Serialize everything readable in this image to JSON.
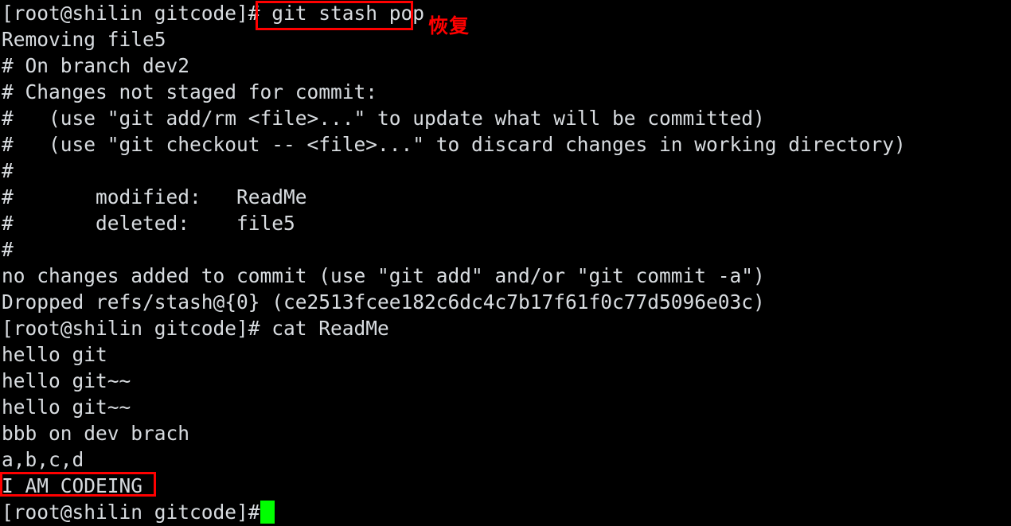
{
  "terminal": {
    "background_color": "#000000",
    "text_color": "#d8dce0",
    "annotation_color": "#ff0000",
    "cursor_color": "#00ff00",
    "prompt": "[root@shilin gitcode]# ",
    "lines": [
      {
        "id": "line-1",
        "text": "[root@shilin gitcode]# git stash pop"
      },
      {
        "id": "line-2",
        "text": "Removing file5"
      },
      {
        "id": "line-3",
        "text": "# On branch dev2"
      },
      {
        "id": "line-4",
        "text": "# Changes not staged for commit:"
      },
      {
        "id": "line-5",
        "text": "#   (use \"git add/rm <file>...\" to update what will be committed)"
      },
      {
        "id": "line-6",
        "text": "#   (use \"git checkout -- <file>...\" to discard changes in working directory)"
      },
      {
        "id": "line-7",
        "text": "#"
      },
      {
        "id": "line-8",
        "text": "#       modified:   ReadMe"
      },
      {
        "id": "line-9",
        "text": "#       deleted:    file5"
      },
      {
        "id": "line-10",
        "text": "#"
      },
      {
        "id": "line-11",
        "text": "no changes added to commit (use \"git add\" and/or \"git commit -a\")"
      },
      {
        "id": "line-12",
        "text": "Dropped refs/stash@{0} (ce2513fcee182c6dc4c7b17f61f0c77d5096e03c)"
      },
      {
        "id": "line-13",
        "text": "[root@shilin gitcode]# cat ReadMe"
      },
      {
        "id": "line-14",
        "text": "hello git"
      },
      {
        "id": "line-15",
        "text": "hello git~~"
      },
      {
        "id": "line-16",
        "text": "hello git~~"
      },
      {
        "id": "line-17",
        "text": "bbb on dev brach"
      },
      {
        "id": "line-18",
        "text": "a,b,c,d"
      },
      {
        "id": "line-19",
        "text": "I AM CODEING"
      },
      {
        "id": "line-20",
        "text": "[root@shilin gitcode]# "
      }
    ],
    "annotations": {
      "command_box_label": "git stash pop",
      "codeing_box_label": "I AM CODEING",
      "note_text": "恢复"
    }
  }
}
